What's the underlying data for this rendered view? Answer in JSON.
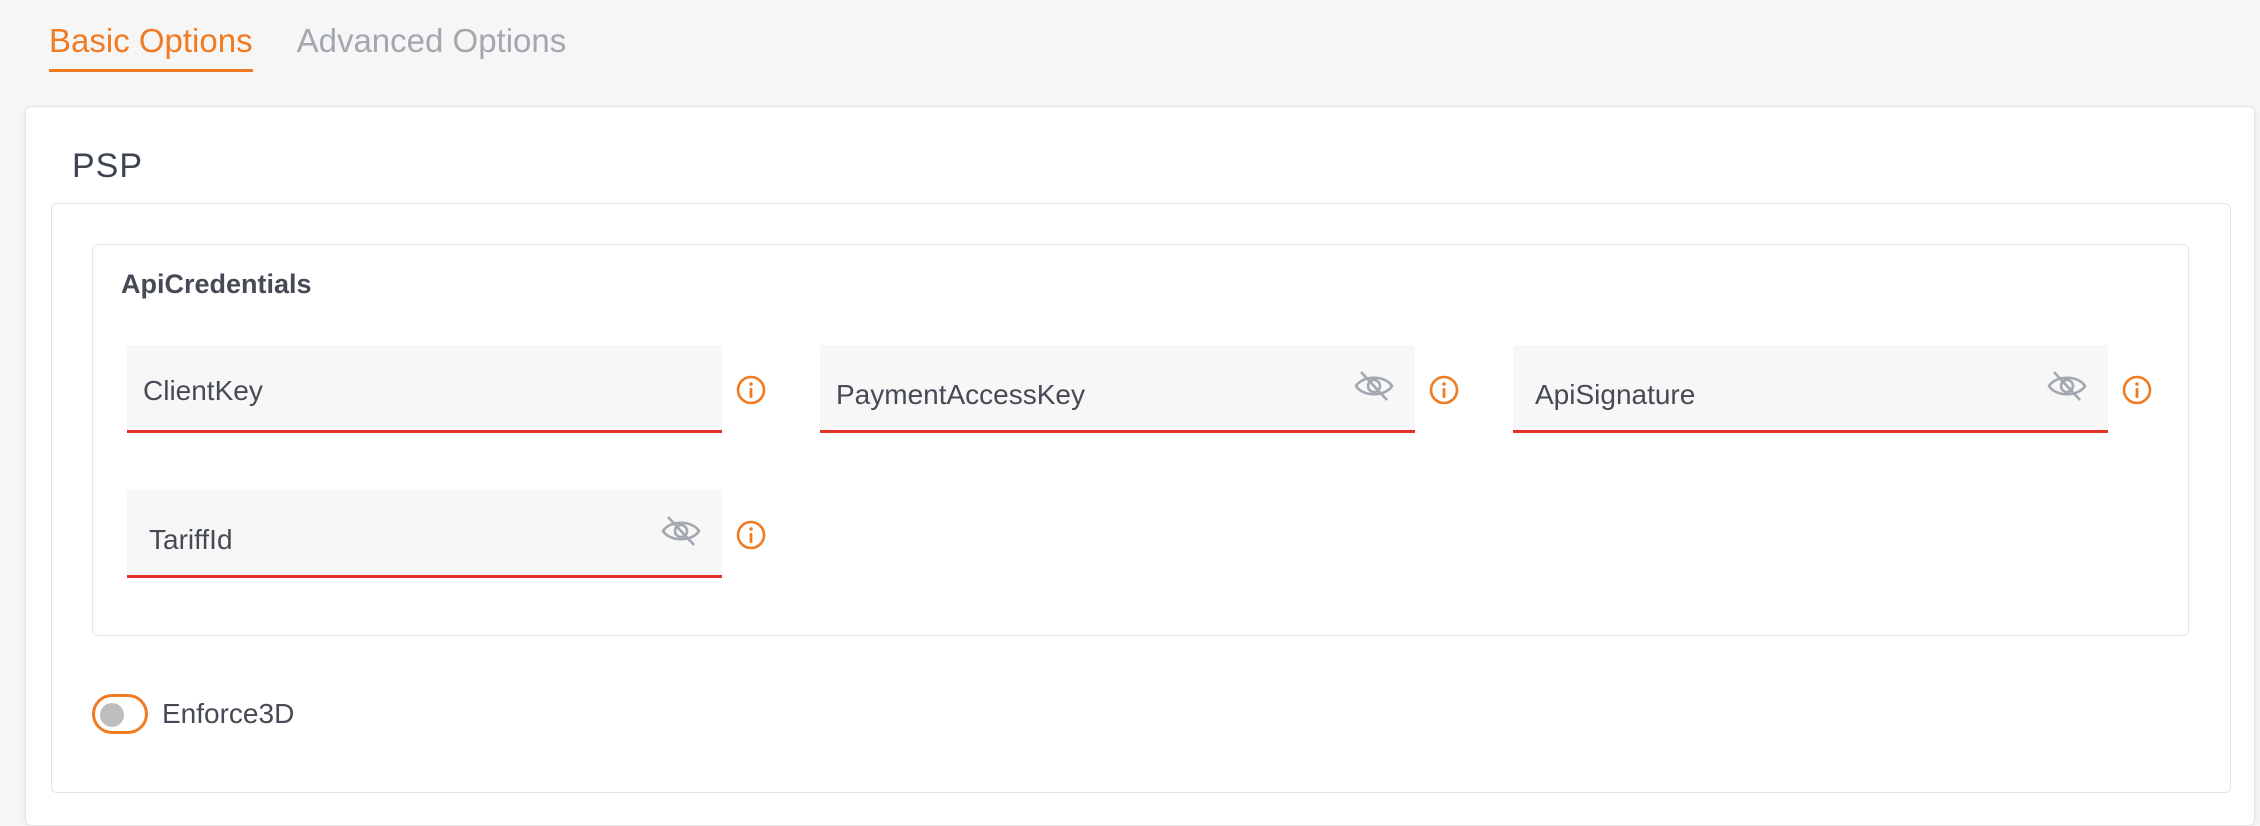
{
  "tabs": [
    {
      "label": "Basic Options",
      "active": true
    },
    {
      "label": "Advanced Options",
      "active": false
    }
  ],
  "section": {
    "title": "PSP",
    "group": {
      "title": "ApiCredentials",
      "fields": [
        {
          "label": "ClientKey",
          "has_visibility_toggle": false,
          "visibility_icon": "eye-off-icon",
          "info_icon": "info-icon"
        },
        {
          "label": "PaymentAccessKey",
          "has_visibility_toggle": true,
          "visibility_icon": "eye-off-icon",
          "info_icon": "info-icon"
        },
        {
          "label": "ApiSignature",
          "has_visibility_toggle": true,
          "visibility_icon": "eye-off-icon",
          "info_icon": "info-icon"
        },
        {
          "label": "TariffId",
          "has_visibility_toggle": true,
          "visibility_icon": "eye-off-icon",
          "info_icon": "info-icon"
        }
      ]
    },
    "toggle": {
      "label": "Enforce3D",
      "checked": false
    }
  },
  "colors": {
    "accent": "#f07b22",
    "error_underline": "#e2332b",
    "icon_gray": "#a3a8b0",
    "text": "#454a54"
  }
}
